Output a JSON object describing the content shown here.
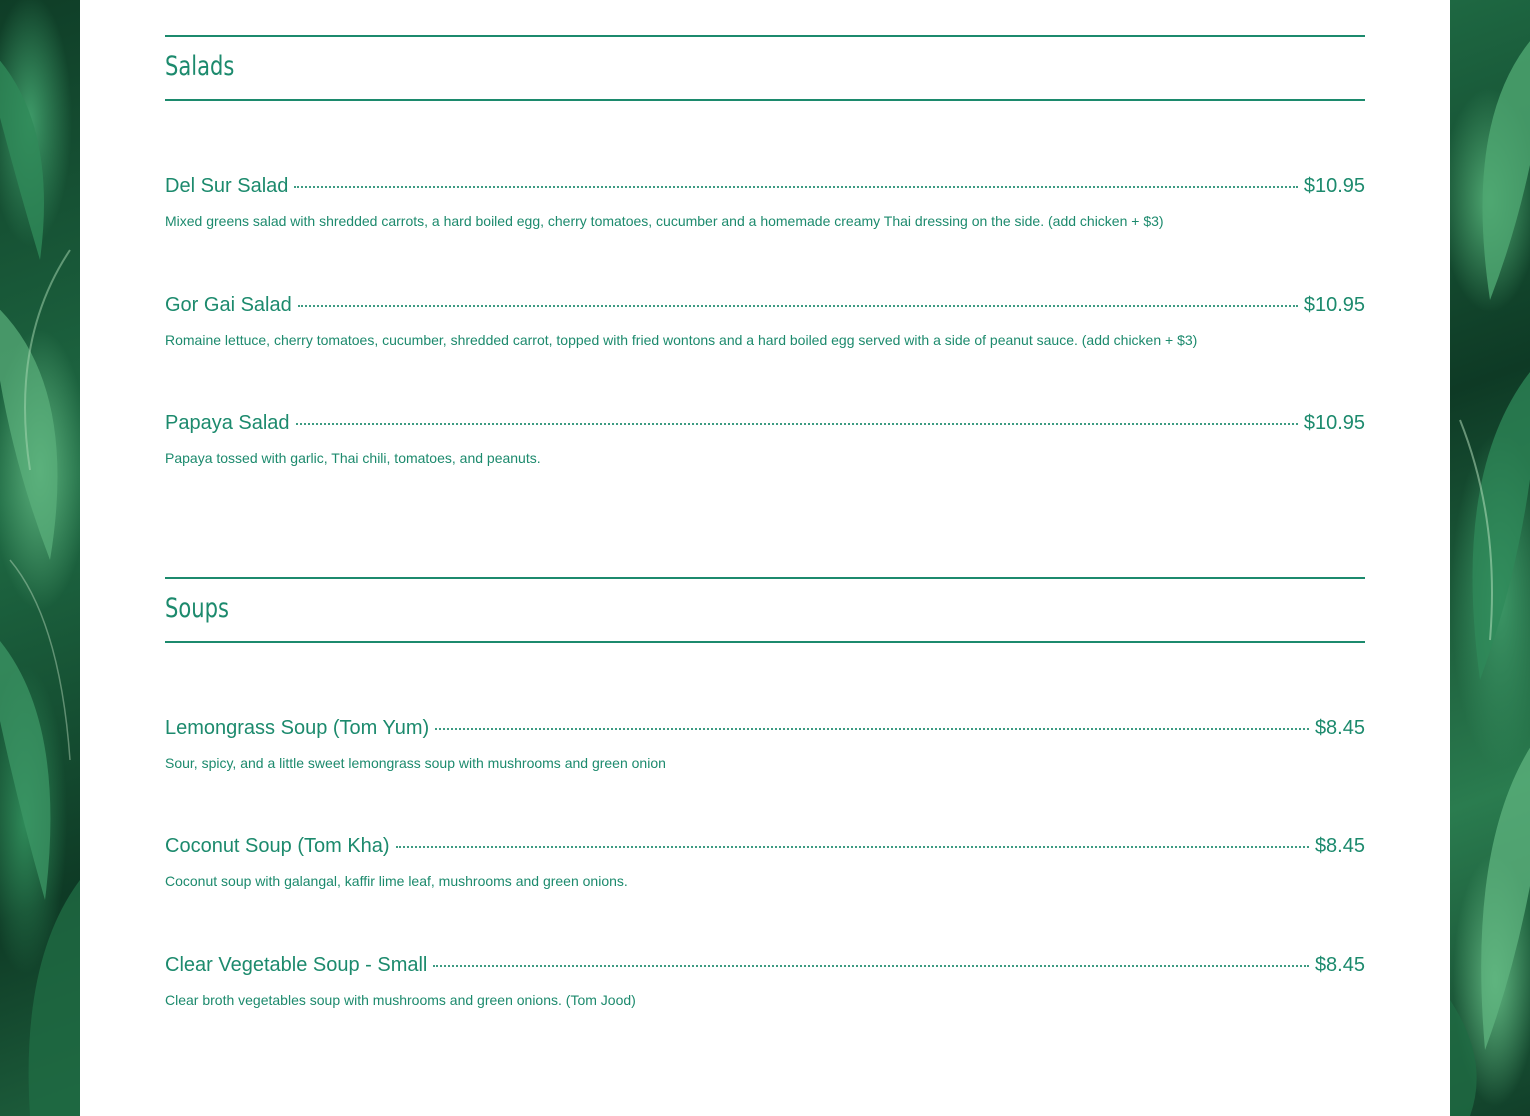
{
  "theme": {
    "accent": "#1c8a6d",
    "panel_background": "#ffffff",
    "backdrop": "tropical-leaves"
  },
  "sections": [
    {
      "title": "Salads",
      "items": [
        {
          "name": "Del Sur Salad",
          "price": "$10.95",
          "description": "Mixed greens salad with shredded carrots, a hard boiled egg, cherry tomatoes, cucumber and a homemade creamy Thai dressing on the side. (add chicken + $3)"
        },
        {
          "name": "Gor Gai Salad",
          "price": "$10.95",
          "description": "Romaine lettuce, cherry tomatoes, cucumber, shredded carrot, topped with fried wontons and a hard boiled egg served with a side of peanut sauce. (add chicken + $3)"
        },
        {
          "name": "Papaya Salad",
          "price": "$10.95",
          "description": "Papaya tossed with garlic, Thai chili, tomatoes, and peanuts."
        }
      ]
    },
    {
      "title": "Soups",
      "items": [
        {
          "name": "Lemongrass Soup (Tom Yum)",
          "price": "$8.45",
          "description": "Sour, spicy, and a little sweet lemongrass soup with mushrooms and green onion"
        },
        {
          "name": "Coconut Soup (Tom Kha)",
          "price": "$8.45",
          "description": "Coconut soup with galangal, kaffir lime leaf, mushrooms and green onions."
        },
        {
          "name": "Clear Vegetable Soup - Small",
          "price": "$8.45",
          "description": "Clear broth vegetables soup with mushrooms and green onions. (Tom Jood)"
        }
      ]
    }
  ]
}
